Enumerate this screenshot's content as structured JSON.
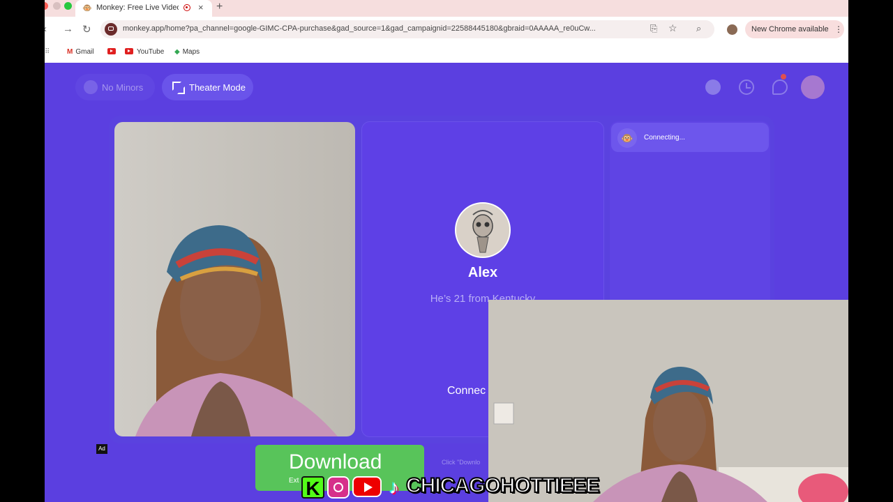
{
  "browser": {
    "tab": {
      "title": "Monkey: Free Live Video C"
    },
    "url": "monkey.app/home?pa_channel=google-GIMC-CPA-purchase&gad_source=1&gad_campaignid=22588445180&gbraid=0AAAAA_re0uCw...",
    "update_chip": "New Chrome available",
    "bookmarks": [
      {
        "label": "Gmail",
        "icon": "gmail-icon"
      },
      {
        "label": "",
        "icon": "youtube-icon"
      },
      {
        "label": "YouTube",
        "icon": "youtube-icon"
      },
      {
        "label": "Maps",
        "icon": "maps-icon"
      }
    ]
  },
  "app": {
    "no_minors": "No Minors",
    "theater_mode": "Theater Mode",
    "match": {
      "name": "Alex",
      "description": "He’s 21 from Kentucky",
      "connect_text": "Connec"
    },
    "chat": {
      "status": "Connecting..."
    },
    "ad": {
      "badge": "Ad",
      "button_main": "Download",
      "button_sub": "Ext",
      "note": "Click \"Downlo"
    }
  },
  "overlay": {
    "handle": "CHICAGOHOTTIEEE",
    "social_icons": [
      "kick-icon",
      "instagram-icon",
      "youtube-icon",
      "tiktok-icon"
    ]
  },
  "colors": {
    "app_bg": "#5b3fe0",
    "panel": "#5e40e6",
    "download_green": "#58c45a",
    "tabstrip": "#f6dede"
  }
}
